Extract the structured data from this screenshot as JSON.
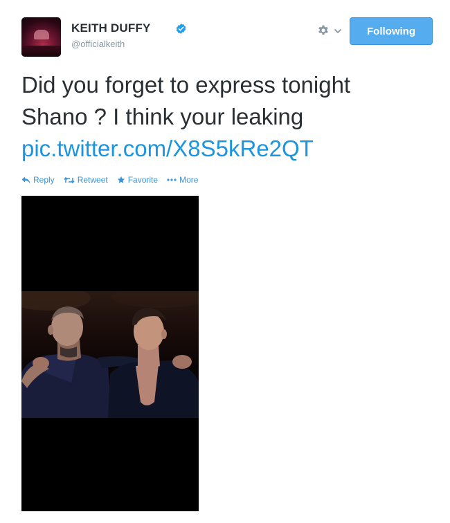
{
  "tweet": {
    "display_name": "KEITH DUFFY",
    "screen_name": "@officialkeith",
    "verified": true,
    "follow_label": "Following",
    "text_line1": "Did you forget to express tonight",
    "text_line2": "Shano ? I think your leaking",
    "link_text": "pic.twitter.com/X8S5kRe2QT"
  },
  "actions": {
    "reply": "Reply",
    "retweet": "Retweet",
    "favorite": "Favorite",
    "more": "More"
  },
  "colors": {
    "accent": "#55acee",
    "link": "#1b95e0",
    "text": "#292f33",
    "muted": "#8899a6"
  },
  "icons": [
    "verified-badge-icon",
    "gear-icon",
    "chevron-down-icon",
    "reply-icon",
    "retweet-icon",
    "star-icon",
    "more-dots-icon"
  ]
}
